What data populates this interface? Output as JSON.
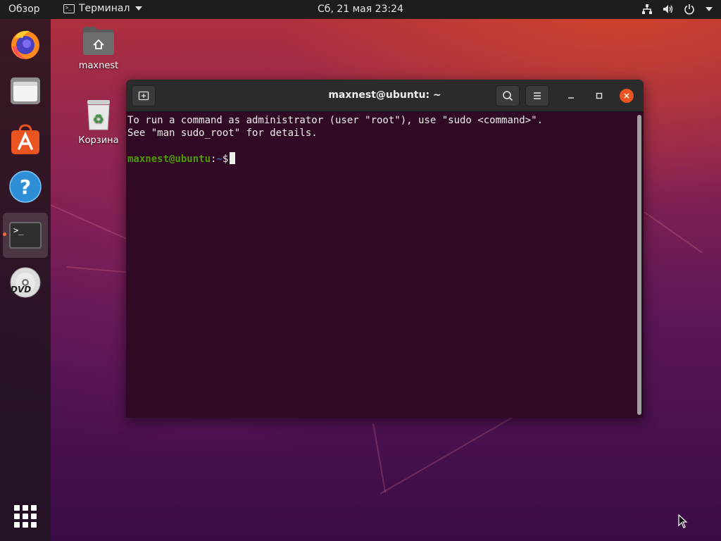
{
  "topbar": {
    "activities_label": "Обзор",
    "app_menu_label": "Терминал",
    "clock": "Сб, 21 мая  23:24"
  },
  "desktop": {
    "icons": [
      {
        "label": "maxnest",
        "icon": "home-folder-icon"
      },
      {
        "label": "Корзина",
        "icon": "trash-icon"
      }
    ]
  },
  "dock": {
    "items": [
      {
        "name": "firefox",
        "icon": "firefox-icon"
      },
      {
        "name": "files",
        "icon": "files-icon"
      },
      {
        "name": "software",
        "icon": "software-store-icon"
      },
      {
        "name": "help",
        "icon": "help-icon"
      },
      {
        "name": "terminal",
        "icon": "terminal-icon",
        "active": true
      },
      {
        "name": "dvd",
        "icon": "dvd-icon"
      }
    ],
    "dvd_label": "DVD",
    "terminal_glyph": ">_"
  },
  "terminal": {
    "title": "maxnest@ubuntu: ~",
    "lines": [
      "To run a command as administrator (user \"root\"), use \"sudo <command>\".",
      "See \"man sudo_root\" for details."
    ],
    "prompt_user": "maxnest@ubuntu",
    "prompt_sep": ":",
    "prompt_path": "~",
    "prompt_symbol": "$"
  },
  "colors": {
    "accent": "#e95420",
    "terminal_bg": "#300a24",
    "prompt_user": "#4e9a06",
    "prompt_path": "#3465a4"
  }
}
